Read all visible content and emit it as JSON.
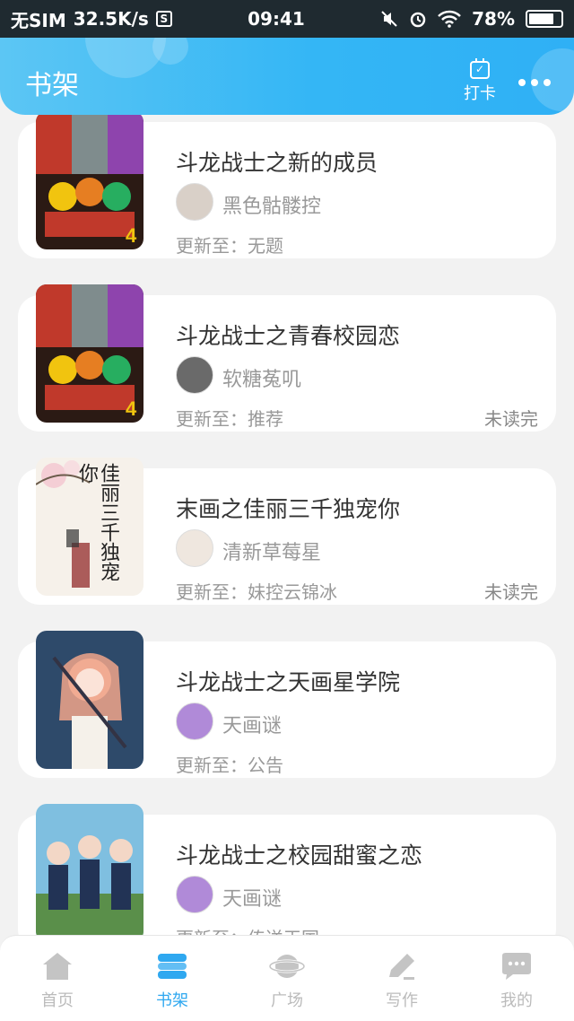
{
  "status_bar": {
    "sim": "无SIM",
    "speed": "32.5K/s",
    "sim_badge": "S",
    "time": "09:41",
    "battery": "78%",
    "battery_level": 0.78
  },
  "header": {
    "title": "书架",
    "checkin_label": "打卡"
  },
  "books": [
    {
      "title": "斗龙战士之新的成员",
      "author": "黑色骷髅控",
      "update": "更新至：无题",
      "status": "",
      "cover_style": "mecha",
      "avatar_color": "#d9d0c8"
    },
    {
      "title": "斗龙战士之青春校园恋",
      "author": "软糖菟叽",
      "update": "更新至：推荐",
      "status": "未读完",
      "cover_style": "mecha",
      "avatar_color": "#6a6a6a"
    },
    {
      "title": "末画之佳丽三千独宠你",
      "author": "清新草莓星",
      "update": "更新至：妹控云锦冰",
      "status": "未读完",
      "cover_style": "calligraphy",
      "cover_text": "佳丽三千独宠你",
      "avatar_color": "#efe7df"
    },
    {
      "title": "斗龙战士之天画星学院",
      "author": "天画谜",
      "update": "更新至：公告",
      "status": "",
      "cover_style": "anime-girl",
      "avatar_color": "#b08ad8"
    },
    {
      "title": "斗龙战士之校园甜蜜之恋",
      "author": "天画谜",
      "update": "更新至：传送王国",
      "status": "",
      "cover_style": "anime-group",
      "avatar_color": "#b08ad8"
    }
  ],
  "tabs": [
    {
      "label": "首页",
      "icon": "home-icon",
      "active": false
    },
    {
      "label": "书架",
      "icon": "bookshelf-icon",
      "active": true
    },
    {
      "label": "广场",
      "icon": "planet-icon",
      "active": false
    },
    {
      "label": "写作",
      "icon": "pen-icon",
      "active": false
    },
    {
      "label": "我的",
      "icon": "chat-icon",
      "active": false
    }
  ],
  "colors": {
    "accent": "#2fa8f0",
    "header_start": "#5cc6f4",
    "header_end": "#2fb0f5"
  }
}
